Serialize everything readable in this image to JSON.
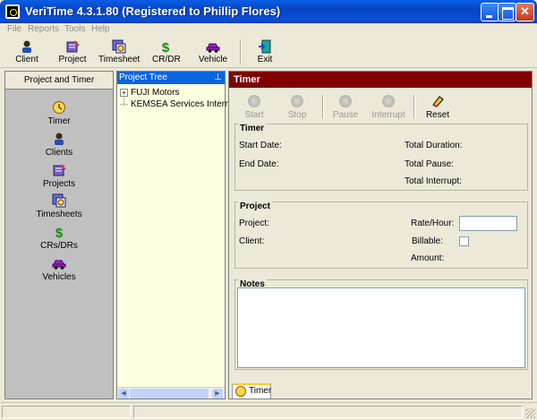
{
  "window": {
    "title": "VeriTime 4.3.1.80 (Registered to Phillip Flores)",
    "min_label": "_",
    "max_label": "□",
    "close_label": "✕"
  },
  "menu": [
    "File",
    "Reports",
    "Tools",
    "Help"
  ],
  "toolbar": {
    "items": [
      {
        "label": "Client",
        "icon": "client-icon"
      },
      {
        "label": "Project",
        "icon": "project-icon"
      },
      {
        "label": "Timesheet",
        "icon": "timesheet-icon"
      },
      {
        "label": "CR/DR",
        "icon": "dollar-icon"
      },
      {
        "label": "Vehicle",
        "icon": "car-icon"
      },
      {
        "label": "Exit",
        "icon": "exit-door-icon"
      }
    ]
  },
  "left_panel": {
    "header": "Project and Timer",
    "items": [
      {
        "label": "Timer",
        "icon": "clock-icon"
      },
      {
        "label": "Clients",
        "icon": "client-icon"
      },
      {
        "label": "Projects",
        "icon": "project-icon"
      },
      {
        "label": "Timesheets",
        "icon": "timesheet-icon"
      },
      {
        "label": "CRs/DRs",
        "icon": "dollar-icon"
      },
      {
        "label": "Vehicles",
        "icon": "car-icon"
      }
    ]
  },
  "project_tree": {
    "header": "Project Tree",
    "pin": "⊥",
    "nodes": [
      {
        "label": "FUJI Motors",
        "expander": "+"
      },
      {
        "label": "KEMSEA Services Internat",
        "expander": ""
      }
    ],
    "scroll_left": "◀",
    "scroll_right": "▶"
  },
  "timer_panel": {
    "header": "Timer",
    "buttons": [
      {
        "label": "Start",
        "enabled": false
      },
      {
        "label": "Stop",
        "enabled": false
      },
      {
        "label": "Pause",
        "enabled": false
      },
      {
        "label": "Interrupt",
        "enabled": false
      },
      {
        "label": "Reset",
        "enabled": true
      }
    ],
    "timer_group": {
      "title": "Timer",
      "start_date": "Start Date:",
      "end_date": "End Date:",
      "total_duration": "Total Duration:",
      "total_pause": "Total Pause:",
      "total_interrupt": "Total Interrupt:"
    },
    "project_group": {
      "title": "Project",
      "project": "Project:",
      "client": "Client:",
      "rate_hour": "Rate/Hour:",
      "rate_value": "",
      "billable": "Billable:",
      "billable_checked": false,
      "amount": "Amount:"
    },
    "notes_group": {
      "title": "Notes",
      "value": "",
      "scroll_up": "▲",
      "scroll_down": "▼"
    },
    "tab": "Timer"
  },
  "colors": {
    "timer_header": "#800000",
    "tree_header": "#0a64e0",
    "tree_background": "#ffffe1",
    "nav_background": "#c0c0c0"
  }
}
